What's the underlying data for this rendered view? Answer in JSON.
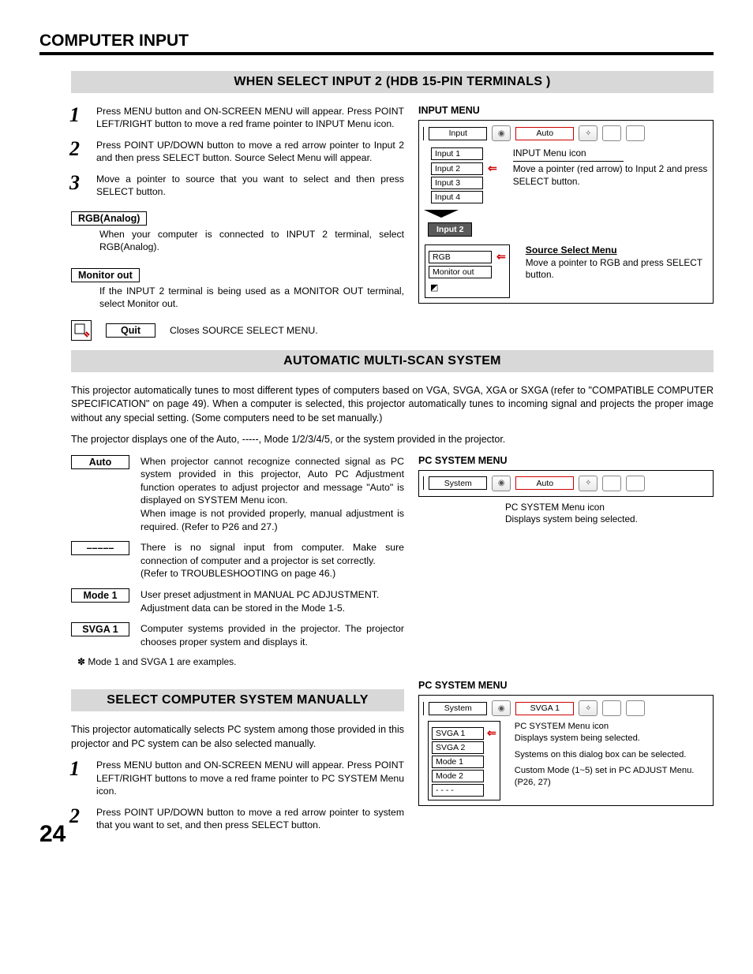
{
  "page_title": "COMPUTER INPUT",
  "page_number": "24",
  "section1": {
    "banner": "WHEN SELECT INPUT 2 (HDB 15-PIN TERMINALS )",
    "steps": [
      "Press MENU button and ON-SCREEN MENU will appear.  Press POINT LEFT/RIGHT button to move a red frame pointer to INPUT Menu icon.",
      "Press POINT UP/DOWN button to move a red arrow pointer to Input 2 and then press SELECT button.  Source Select Menu will appear.",
      "Move a pointer to source that you want to select and then press SELECT button."
    ],
    "options": [
      {
        "label": "RGB(Analog)",
        "desc": "When your computer is connected to INPUT 2 terminal, select RGB(Analog)."
      },
      {
        "label": "Monitor out",
        "desc": "If the INPUT 2 terminal is being used as a MONITOR OUT terminal, select Monitor out."
      }
    ],
    "quit": {
      "label": "Quit",
      "desc": "Closes SOURCE SELECT MENU."
    },
    "input_menu": {
      "title": "INPUT MENU",
      "header_left": "Input",
      "header_right": "Auto",
      "items": [
        "Input 1",
        "Input 2",
        "Input 3",
        "Input 4"
      ],
      "callout1_title": "INPUT Menu icon",
      "callout1_text": "Move a pointer (red arrow) to Input 2 and press SELECT button.",
      "chip": "Input 2",
      "source": {
        "items": [
          "RGB",
          "Monitor out"
        ],
        "callout_title": "Source Select Menu",
        "callout_text": "Move a pointer to RGB and press SELECT button."
      }
    }
  },
  "section2": {
    "banner": "AUTOMATIC MULTI-SCAN SYSTEM",
    "para1": "This projector automatically tunes to most different types of computers based on VGA, SVGA, XGA or SXGA (refer to \"COMPATIBLE COMPUTER SPECIFICATION\" on page 49).  When a computer is selected, this projector automatically tunes to incoming signal and projects the proper image without any special setting.  (Some computers need to be set manually.)",
    "para2": "The projector displays one of the Auto, -----, Mode 1/2/3/4/5, or the system provided in the projector.",
    "modes": [
      {
        "label": "Auto",
        "text": "When projector cannot recognize connected signal as PC system provided in this projector, Auto PC Adjustment function operates to adjust projector and message \"Auto\" is displayed on SYSTEM Menu icon.\nWhen image is not provided properly, manual adjustment is required.  (Refer to P26 and 27.)"
      },
      {
        "label": "–––––",
        "text": "There is no signal input from computer.  Make sure connection of computer and a projector is set correctly.\n(Refer to TROUBLESHOOTING on page 46.)"
      },
      {
        "label": "Mode 1",
        "text": "User preset adjustment in MANUAL PC ADJUSTMENT.\nAdjustment data can be stored in the Mode 1-5."
      },
      {
        "label": "SVGA 1",
        "text": "Computer systems provided in the projector. The projector chooses proper system and displays it."
      }
    ],
    "footnote": "✽  Mode 1 and SVGA 1 are examples.",
    "pc_menu1": {
      "title": "PC SYSTEM MENU",
      "header_left": "System",
      "header_right": "Auto",
      "callout": "PC SYSTEM Menu icon\nDisplays system being selected."
    }
  },
  "section3": {
    "banner": "SELECT COMPUTER SYSTEM MANUALLY",
    "para": "This projector automatically selects PC system among those provided in this projector and PC system can be also selected manually.",
    "steps": [
      "Press MENU button and ON-SCREEN MENU will appear.  Press POINT LEFT/RIGHT buttons to move a red frame pointer to PC SYSTEM Menu icon.",
      "Press POINT UP/DOWN button to move a red arrow pointer to system that you want to set, and then press SELECT button."
    ],
    "pc_menu2": {
      "title": "PC SYSTEM MENU",
      "header_left": "System",
      "header_right": "SVGA 1",
      "items": [
        "SVGA 1",
        "SVGA 2",
        "Mode 1",
        "Mode 2",
        "- - - -"
      ],
      "callouts": [
        "PC SYSTEM Menu icon\nDisplays system being selected.",
        "Systems on this dialog box can be selected.",
        "Custom Mode (1~5) set in PC ADJUST Menu.  (P26, 27)"
      ]
    }
  }
}
